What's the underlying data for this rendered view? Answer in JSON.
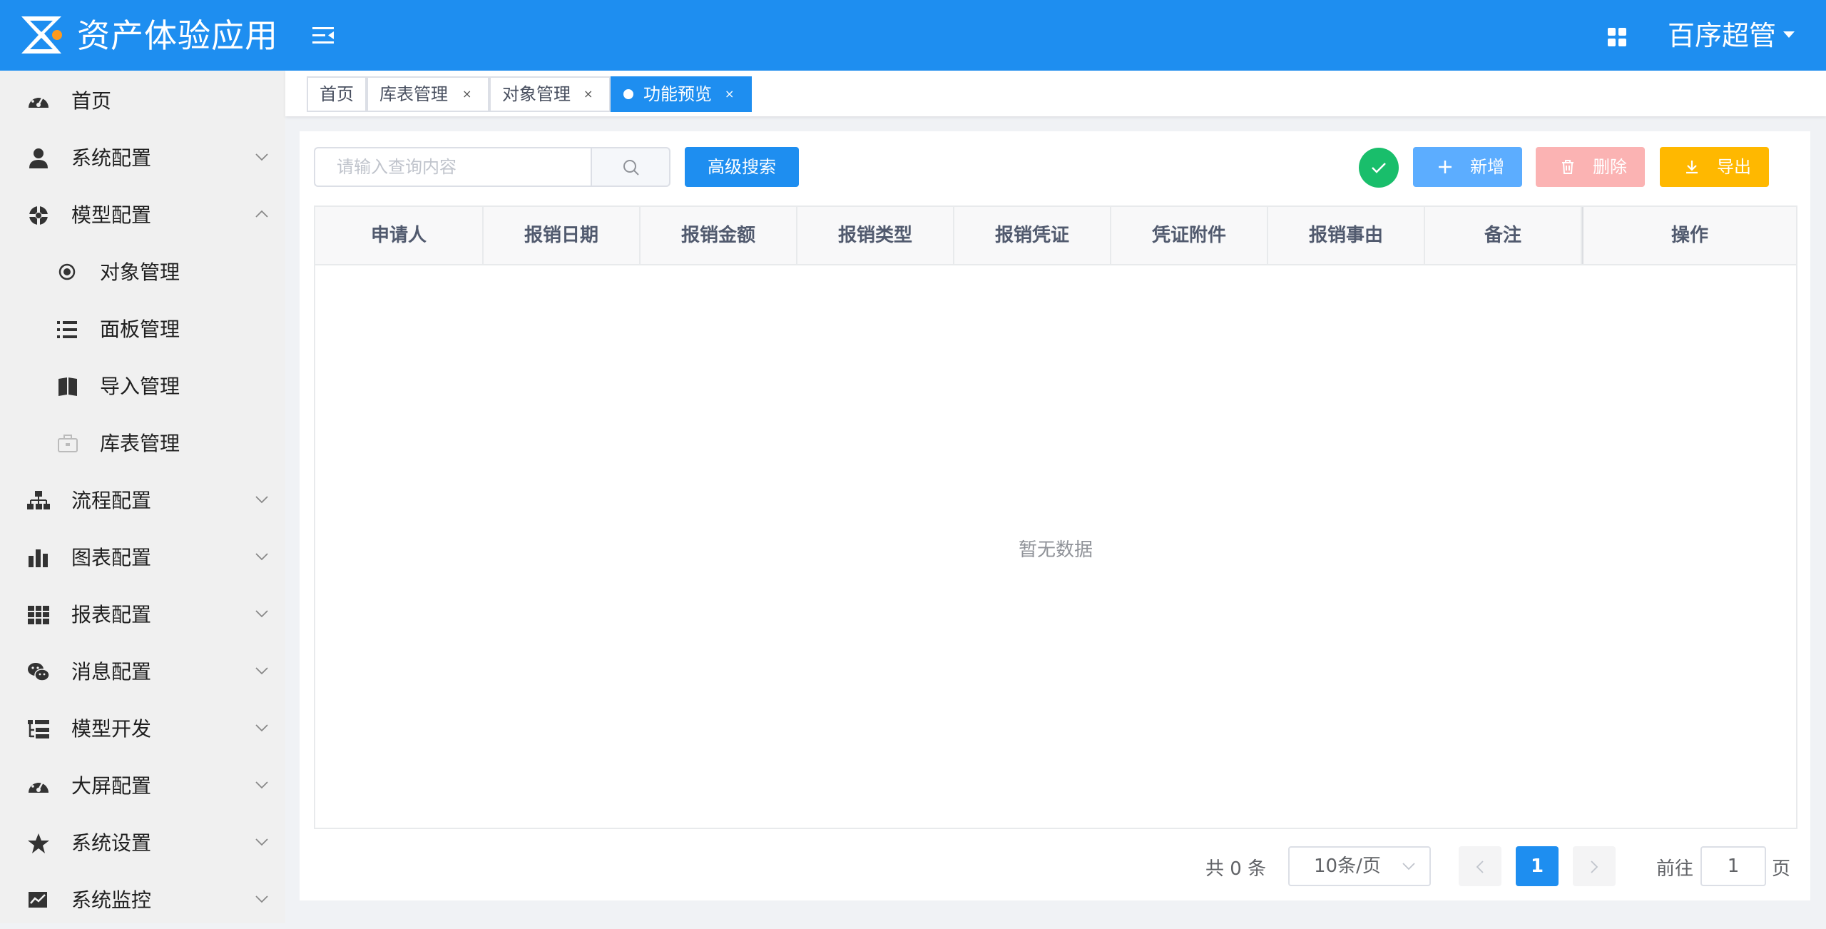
{
  "header": {
    "app_title": "资产体验应用",
    "user_name": "百序超管"
  },
  "sidebar": {
    "items": [
      {
        "label": "首页",
        "icon": "dashboard-icon"
      },
      {
        "label": "系统配置",
        "icon": "user-icon",
        "expandable": true
      },
      {
        "label": "模型配置",
        "icon": "model-icon",
        "expandable": true,
        "expanded": true
      },
      {
        "label": "对象管理",
        "icon": "radio-dot-icon",
        "sub": true
      },
      {
        "label": "面板管理",
        "icon": "list-icon",
        "sub": true
      },
      {
        "label": "导入管理",
        "icon": "book-icon",
        "sub": true
      },
      {
        "label": "库表管理",
        "icon": "briefcase-icon",
        "sub": true
      },
      {
        "label": "流程配置",
        "icon": "sitemap-icon",
        "expandable": true
      },
      {
        "label": "图表配置",
        "icon": "bar-chart-icon",
        "expandable": true
      },
      {
        "label": "报表配置",
        "icon": "table-icon",
        "expandable": true
      },
      {
        "label": "消息配置",
        "icon": "wechat-icon",
        "expandable": true
      },
      {
        "label": "模型开发",
        "icon": "tree-icon",
        "expandable": true
      },
      {
        "label": "大屏配置",
        "icon": "dashboard-icon",
        "expandable": true
      },
      {
        "label": "系统设置",
        "icon": "star-icon",
        "expandable": true
      },
      {
        "label": "系统监控",
        "icon": "monitor-icon",
        "expandable": true
      }
    ]
  },
  "tabs": [
    {
      "label": "首页",
      "closable": false,
      "active": false
    },
    {
      "label": "库表管理",
      "closable": true,
      "active": false
    },
    {
      "label": "对象管理",
      "closable": true,
      "active": false
    },
    {
      "label": "功能预览",
      "closable": true,
      "active": true
    }
  ],
  "tab_close_glyph": "×",
  "toolbar": {
    "search_placeholder": "请输入查询内容",
    "advanced_search": "高级搜索",
    "add_label": "新增",
    "delete_label": "删除",
    "export_label": "导出"
  },
  "table": {
    "columns": [
      "申请人",
      "报销日期",
      "报销金额",
      "报销类型",
      "报销凭证",
      "凭证附件",
      "报销事由",
      "备注",
      "操作"
    ],
    "rows": [],
    "empty_text": "暂无数据"
  },
  "pagination": {
    "total_text": "共 0 条",
    "page_size": "10条/页",
    "current_page": "1",
    "goto_label": "前往",
    "goto_value": "1",
    "page_suffix": "页"
  },
  "colors": {
    "primary": "#1e8ef0",
    "success": "#19be6b",
    "add": "#5cadff",
    "delete": "#fbb3b3",
    "export": "#ffb800"
  }
}
